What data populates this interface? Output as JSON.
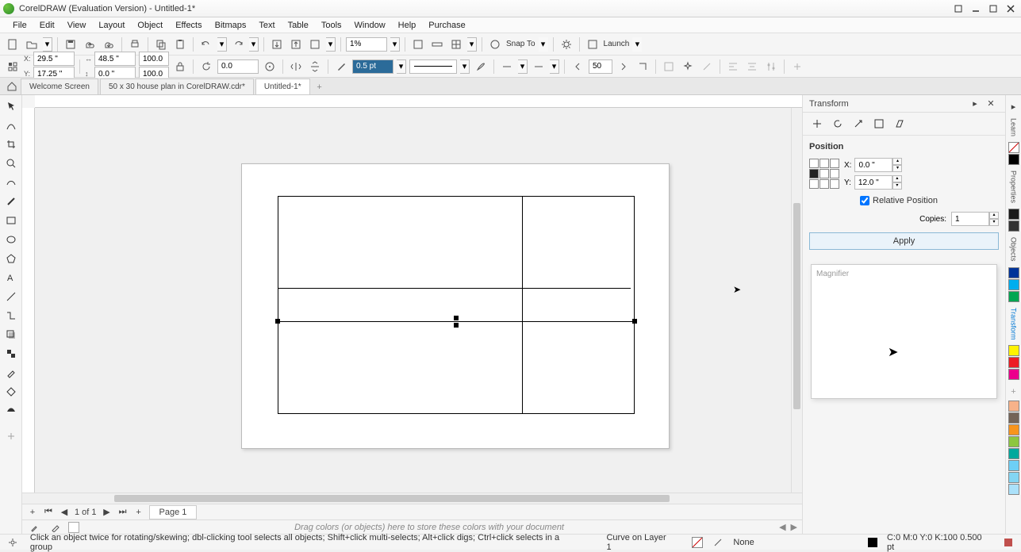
{
  "title": "CorelDRAW (Evaluation Version) - Untitled-1*",
  "menu": [
    "File",
    "Edit",
    "View",
    "Layout",
    "Object",
    "Effects",
    "Bitmaps",
    "Text",
    "Table",
    "Tools",
    "Window",
    "Help",
    "Purchase"
  ],
  "toolbar1": {
    "zoom": "1%",
    "snap": "Snap To",
    "launch": "Launch"
  },
  "toolbar2": {
    "x": "29.5 \"",
    "y": "17.25 \"",
    "w": "48.5 \"",
    "h": "0.0 \"",
    "sx": "100.0",
    "sy": "100.0",
    "rot": "0.0",
    "outline_width": "0.5 pt",
    "arrow_size": "50"
  },
  "tabs": {
    "t1": "Welcome Screen",
    "t2": "50 x 30 house plan in CorelDRAW.cdr*",
    "t3": "Untitled-1*"
  },
  "pagenav": {
    "page_of": "1  of  1",
    "page_tab": "Page 1"
  },
  "colorwell_hint": "Drag colors (or objects) here to store these colors with your document",
  "status": {
    "hint": "Click an object twice for rotating/skewing; dbl-clicking tool selects all objects; Shift+click multi-selects; Alt+click digs; Ctrl+click selects in a group",
    "layer": "Curve on Layer 1",
    "fill": "None",
    "outline_info": "C:0 M:0 Y:0 K:100  0.500 pt"
  },
  "docker": {
    "title": "Transform",
    "section": "Position",
    "x_label": "X:",
    "y_label": "Y:",
    "x": "0.0 \"",
    "y": "12.0 \"",
    "relative": "Relative Position",
    "copies_label": "Copies:",
    "copies": "1",
    "apply": "Apply",
    "magnifier": "Magnifier"
  },
  "rtabs": [
    "Learn",
    "Properties",
    "Objects",
    "Transform"
  ]
}
